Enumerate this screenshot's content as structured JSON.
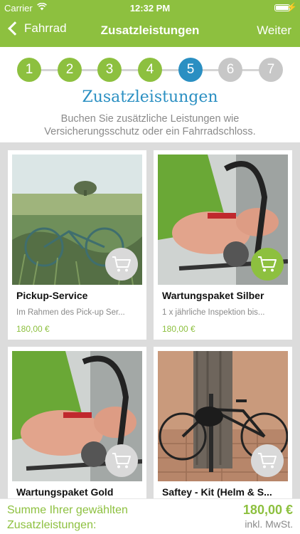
{
  "status_bar": {
    "carrier": "Carrier",
    "time": "12:32 PM"
  },
  "nav": {
    "back_label": "Fahrrad",
    "title": "Zusatzleistungen",
    "next_label": "Weiter"
  },
  "steps": [
    {
      "label": "1",
      "state": "done"
    },
    {
      "label": "2",
      "state": "done"
    },
    {
      "label": "3",
      "state": "done"
    },
    {
      "label": "4",
      "state": "done"
    },
    {
      "label": "5",
      "state": "current"
    },
    {
      "label": "6",
      "state": "upcoming"
    },
    {
      "label": "7",
      "state": "upcoming"
    }
  ],
  "heading": "Zusatzleistungen",
  "subtext": "Buchen Sie zusätzliche Leistungen wie Versicherungsschutz oder ein Fahrradschloss.",
  "products": [
    {
      "title": "Pickup-Service",
      "description": "Im Rahmen des Pick-up Ser...",
      "price": "180,00 €",
      "in_cart": false,
      "image": "bicycle-in-grass-field"
    },
    {
      "title": "Wartungspaket Silber",
      "description": "1 x jährliche Inspektion bis...",
      "price": "180,00 €",
      "in_cart": true,
      "image": "hands-repairing-bicycle"
    },
    {
      "title": "Wartungspaket Gold",
      "description": "",
      "price": "",
      "in_cart": false,
      "image": "hands-repairing-bicycle"
    },
    {
      "title": "Saftey - Kit (Helm & S...",
      "description": "",
      "price": "",
      "in_cart": false,
      "image": "bicycle-locked-at-tree"
    }
  ],
  "footer": {
    "summary_label": "Summe Ihrer gewählten Zusatzleistungen:",
    "total": "180,00 €",
    "tax_note": "inkl. MwSt."
  },
  "colors": {
    "brand_green": "#8dc03f",
    "current_step_blue": "#2a8fc2",
    "inactive_gray": "#c7c7c7",
    "cart_inactive": "#d9d9d9"
  }
}
